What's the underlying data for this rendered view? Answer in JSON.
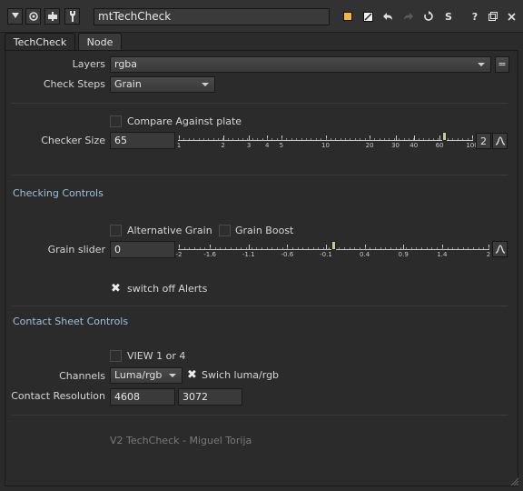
{
  "titlebar": {
    "node_name": "mtTechCheck",
    "icons": [
      "panel-toggle-icon",
      "view-icon",
      "node-color-icon",
      "wrench-icon"
    ],
    "right_icons": [
      "color-swatch-icon",
      "edit-icon",
      "undo-icon",
      "redo-icon",
      "reset-icon",
      "script-icon",
      "help-icon",
      "float-icon",
      "close-icon"
    ],
    "script_label": "S",
    "help_label": "?"
  },
  "tabs": [
    {
      "label": "TechCheck"
    },
    {
      "label": "Node"
    }
  ],
  "layers": {
    "label": "Layers",
    "value": "rgba",
    "eq_label": "="
  },
  "check_steps": {
    "label": "Check Steps",
    "value": "Grain"
  },
  "compare": {
    "label": "Compare Against plate",
    "checked": false
  },
  "checker_size": {
    "label": "Checker Size",
    "value": "65",
    "ticks": [
      "1",
      "2",
      "3",
      "4",
      "5",
      "10",
      "20",
      "30",
      "40",
      "60",
      "100"
    ],
    "slider_value": 65,
    "dim_button": "2"
  },
  "checking_controls": {
    "title": "Checking Controls"
  },
  "alt_grain": {
    "label": "Alternative Grain",
    "checked": false
  },
  "grain_boost": {
    "label": "Grain Boost",
    "checked": false
  },
  "grain_slider": {
    "label": "Grain slider",
    "value": "0",
    "ticks": [
      "-2",
      "-1.6",
      "-1.1",
      "-0.6",
      "-0.1",
      "0.4",
      "0.9",
      "1.4",
      "2"
    ],
    "slider_value": 0
  },
  "switch_alerts": {
    "label": "switch off Alerts",
    "checked": true
  },
  "contact_sheet": {
    "title": "Contact Sheet Controls"
  },
  "view_1_or_4": {
    "label": "VIEW 1 or 4",
    "checked": false
  },
  "channels": {
    "label": "Channels",
    "value": "Luma/rgb"
  },
  "swich_luma": {
    "label": "Swich luma/rgb",
    "checked": true
  },
  "contact_resolution": {
    "label": "Contact Resolution",
    "width": "4608",
    "height": "3072"
  },
  "credit": "V2 TechCheck - Miguel Torija",
  "colors": {
    "background": "#2b2b2b",
    "section": "#9fc1d8",
    "accent": "#f2b830"
  }
}
